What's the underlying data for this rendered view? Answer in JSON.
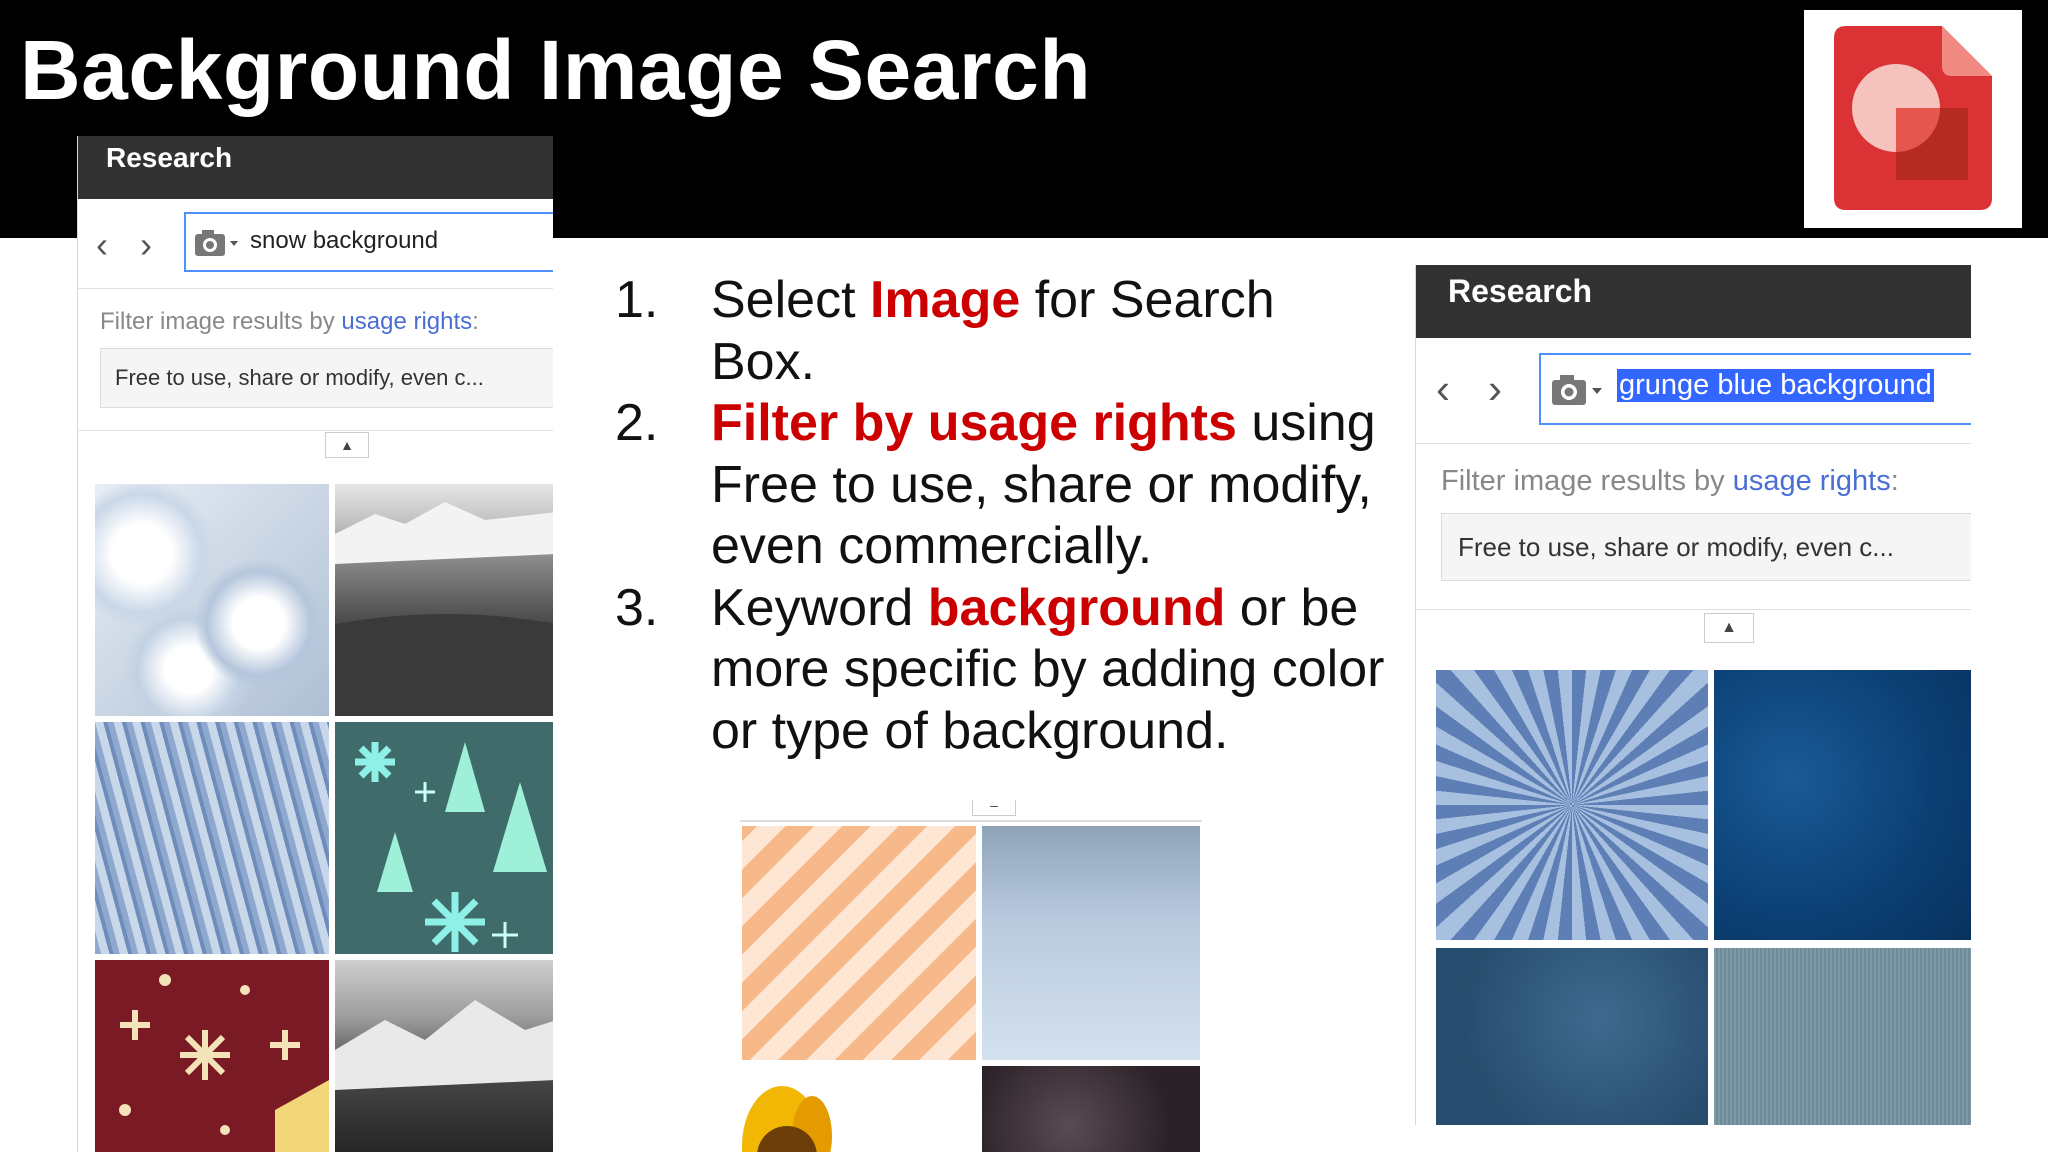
{
  "slide": {
    "title": "Background Image Search"
  },
  "logo": {
    "icon": "google-slides-icon",
    "color": "#db3236"
  },
  "left_panel": {
    "header": "Research",
    "search_query": "snow background",
    "filter_prefix": "Filter image results by ",
    "filter_link": "usage rights",
    "filter_suffix": ":",
    "rights_selected": "Free to use, share or modify, even c...",
    "collapse_glyph": "▲",
    "thumbnails": [
      "snow-surface-image",
      "mountain-forest-bw-image",
      "frosted-trees-image",
      "teal-snowflake-pattern-image",
      "red-snowflake-pattern-image",
      "mountain-range-bw-image"
    ]
  },
  "right_panel": {
    "header": "Research",
    "search_query": "grunge blue background",
    "filter_prefix": "Filter image results by ",
    "filter_link": "usage rights",
    "filter_suffix": ":",
    "rights_selected": "Free to use, share or modify, even c...",
    "collapse_glyph": "▲",
    "thumbnails": [
      "blue-sunburst-image",
      "dark-blue-grunge-image",
      "blue-texture-image",
      "grey-blue-fabric-image"
    ]
  },
  "steps": [
    {
      "num": "1.",
      "pre": "Select ",
      "highlight": "Image",
      "post": " for Search Box."
    },
    {
      "num": "2.",
      "pre": "",
      "highlight": "Filter by usage rights",
      "post": " using Free to use, share or modify, even commercially."
    },
    {
      "num": "3.",
      "pre": "Keyword ",
      "highlight": "background",
      "post": " or be more specific by adding color or type of background."
    }
  ],
  "bottom_grid": {
    "collapse_glyph": "–",
    "thumbnails": [
      "orange-stripes-image",
      "light-blue-gradient-image",
      "sunflower-image",
      "dark-texture-image"
    ]
  },
  "colors": {
    "accent_red": "#cc0000",
    "header_bg": "#000000",
    "panel_header_bg": "#323232",
    "link_blue": "#4a6fd4",
    "selection_blue": "#3366ff"
  }
}
